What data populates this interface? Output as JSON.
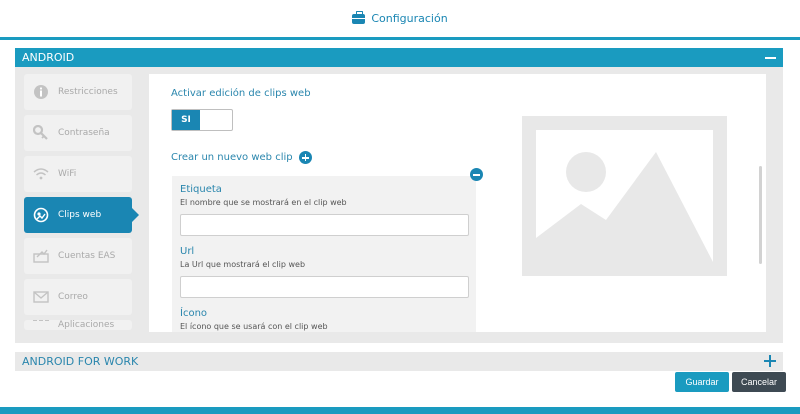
{
  "topbar": {
    "title": "Configuración",
    "icon": "briefcase-icon"
  },
  "panel": {
    "title": "ANDROID",
    "sidebar": [
      {
        "label": "Restricciones",
        "icon": "info-icon",
        "active": false
      },
      {
        "label": "Contraseña",
        "icon": "key-icon",
        "active": false
      },
      {
        "label": "WiFi",
        "icon": "wifi-icon",
        "active": false
      },
      {
        "label": "Clips web",
        "icon": "webclip-icon",
        "active": true
      },
      {
        "label": "Cuentas EAS",
        "icon": "eas-icon",
        "active": false
      },
      {
        "label": "Correo",
        "icon": "mail-icon",
        "active": false
      },
      {
        "label": "Aplicaciones",
        "icon": "apps-icon",
        "active": false
      }
    ],
    "content": {
      "enable_label": "Activar edición de clips web",
      "toggle_on_label": "SI",
      "create_label": "Crear un nuevo web clip",
      "webclip": {
        "tag_label": "Etiqueta",
        "tag_help": "El nombre que se mostrará en el clip web",
        "tag_value": "",
        "url_label": "Url",
        "url_help": "La Url que mostrará el clip web",
        "url_value": "",
        "icon_label": "Ícono",
        "icon_help": "El ícono que se usará con el clip web"
      }
    }
  },
  "panel2": {
    "title": "ANDROID FOR WORK"
  },
  "buttons": {
    "save": "Guardar",
    "cancel": "Cancelar"
  },
  "colors": {
    "accent": "#1a9bc0",
    "accent_dark": "#1a86b3",
    "cancel_bg": "#3e4a53"
  }
}
